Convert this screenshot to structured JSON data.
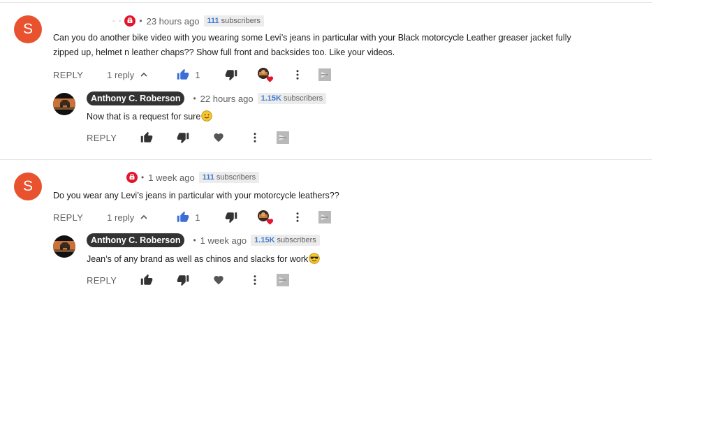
{
  "colors": {
    "avatar_bg": "#e8522f",
    "like_active": "#3a6fd6",
    "subs_count": "#3f7ad0",
    "heart": "#e0162b",
    "verified": "#e0162b"
  },
  "comments": [
    {
      "avatar_letter": "S",
      "author_placeholder": "- -",
      "time": "23 hours ago",
      "subs_count": "111",
      "subs_label": "subscribers",
      "text_line1": "Can you do another bike video with you wearing some Levi’s jeans in particular with your Black motorcycle Leather greaser jacket fully",
      "text_line2": "zipped up, helmet n leather chaps?? Show full front and backsides too. Like your videos.",
      "reply_label": "REPLY",
      "replies_label": "1 reply",
      "likes": "1",
      "icons": [
        "verified-icon",
        "expand-less-icon",
        "thumb-up-icon",
        "thumb-down-icon",
        "creator-heart-icon",
        "more-vert-icon",
        "flag-icon"
      ],
      "reply": {
        "author": "Anthony C. Roberson",
        "time": "22 hours ago",
        "subs_count": "1.15K",
        "subs_label": "subscribers",
        "text": "Now that is a request for sure",
        "emoji": "slightly-smiling-face",
        "reply_label": "REPLY"
      }
    },
    {
      "avatar_letter": "S",
      "author_placeholder": "",
      "time": "1 week ago",
      "subs_count": "111",
      "subs_label": "subscribers",
      "text_line1": "Do you wear any Levi’s jeans in particular with your motorcycle leathers??",
      "reply_label": "REPLY",
      "replies_label": "1 reply",
      "likes": "1",
      "reply": {
        "author": "Anthony C. Roberson",
        "time": "1 week ago",
        "subs_count": "1.15K",
        "subs_label": "subscribers",
        "text": "Jean’s of any brand as well as chinos and slacks for work",
        "emoji": "smiling-face-with-sunglasses",
        "reply_label": "REPLY"
      }
    }
  ]
}
